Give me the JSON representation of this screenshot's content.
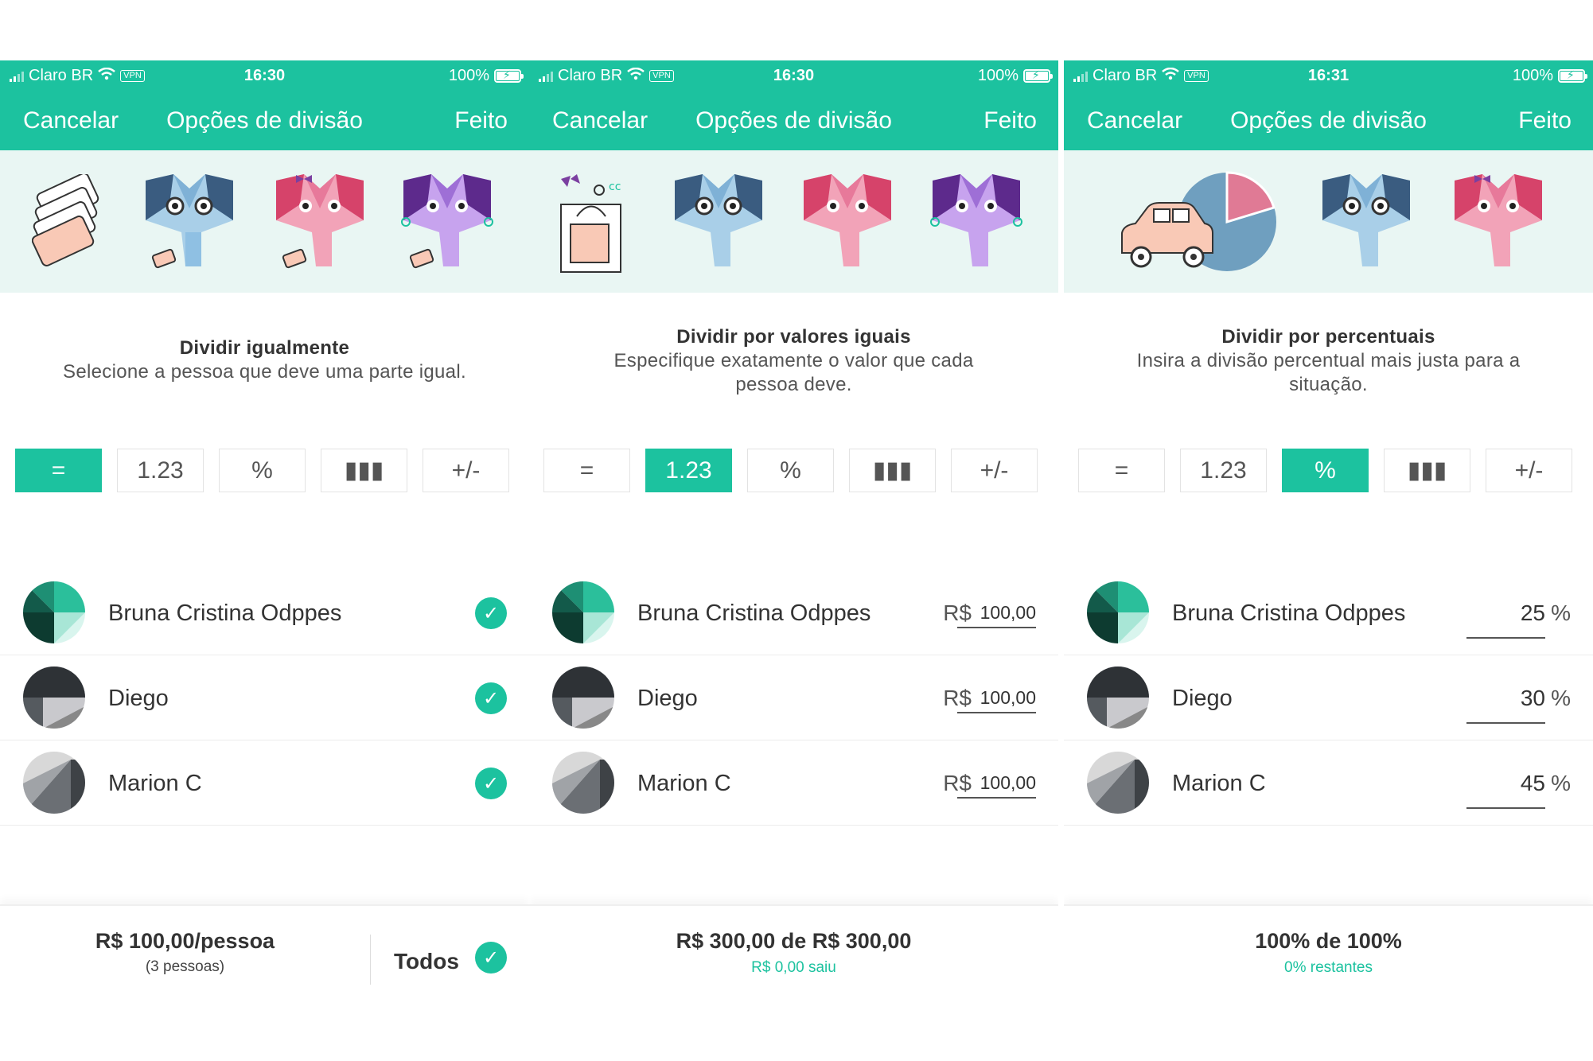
{
  "colors": {
    "accent": "#1cc29f",
    "banner_bg": "#e9f6f3",
    "text": "#333333"
  },
  "screens": [
    {
      "status": {
        "carrier": "Claro BR",
        "vpn": "VPN",
        "time": "16:30",
        "battery": "100%"
      },
      "nav": {
        "cancel": "Cancelar",
        "title": "Opções de divisão",
        "done": "Feito"
      },
      "desc": {
        "title": "Dividir igualmente",
        "subtitle": "Selecione a pessoa que deve uma parte igual."
      },
      "tabs": [
        "=",
        "1.23",
        "%",
        "▮▮▮",
        "+/-"
      ],
      "active_tab": "=",
      "people": [
        {
          "name": "Bruna Cristina Odppes",
          "checked": true
        },
        {
          "name": "Diego",
          "checked": true
        },
        {
          "name": "Marion C",
          "checked": true
        }
      ],
      "footer": {
        "main": "R$ 100,00/pessoa",
        "sub": "(3 pessoas)",
        "all_label": "Todos"
      }
    },
    {
      "status": {
        "carrier": "Claro BR",
        "vpn": "VPN",
        "time": "16:30",
        "battery": "100%"
      },
      "nav": {
        "cancel": "Cancelar",
        "title": "Opções de divisão",
        "done": "Feito"
      },
      "desc": {
        "title": "Dividir por valores iguais",
        "subtitle": "Especifique exatamente o valor que cada pessoa deve."
      },
      "tabs": [
        "=",
        "1.23",
        "%",
        "▮▮▮",
        "+/-"
      ],
      "active_tab": "1.23",
      "currency": "R$",
      "people": [
        {
          "name": "Bruna Cristina Odppes",
          "amount": "100,00"
        },
        {
          "name": "Diego",
          "amount": "100,00"
        },
        {
          "name": "Marion C",
          "amount": "100,00"
        }
      ],
      "footer": {
        "main": "R$ 300,00 de R$ 300,00",
        "sub": "R$ 0,00 saiu"
      }
    },
    {
      "status": {
        "carrier": "Claro BR",
        "vpn": "VPN",
        "time": "16:31",
        "battery": "100%"
      },
      "nav": {
        "cancel": "Cancelar",
        "title": "Opções de divisão",
        "done": "Feito"
      },
      "desc": {
        "title": "Dividir por percentuais",
        "subtitle": "Insira a divisão percentual mais justa para a situação."
      },
      "tabs": [
        "=",
        "1.23",
        "%",
        "▮▮▮",
        "+/-"
      ],
      "active_tab": "%",
      "percent_sign": "%",
      "people": [
        {
          "name": "Bruna Cristina Odppes",
          "percent": "25"
        },
        {
          "name": "Diego",
          "percent": "30"
        },
        {
          "name": "Marion C",
          "percent": "45"
        }
      ],
      "footer": {
        "main": "100% de 100%",
        "sub": "0% restantes"
      }
    }
  ]
}
